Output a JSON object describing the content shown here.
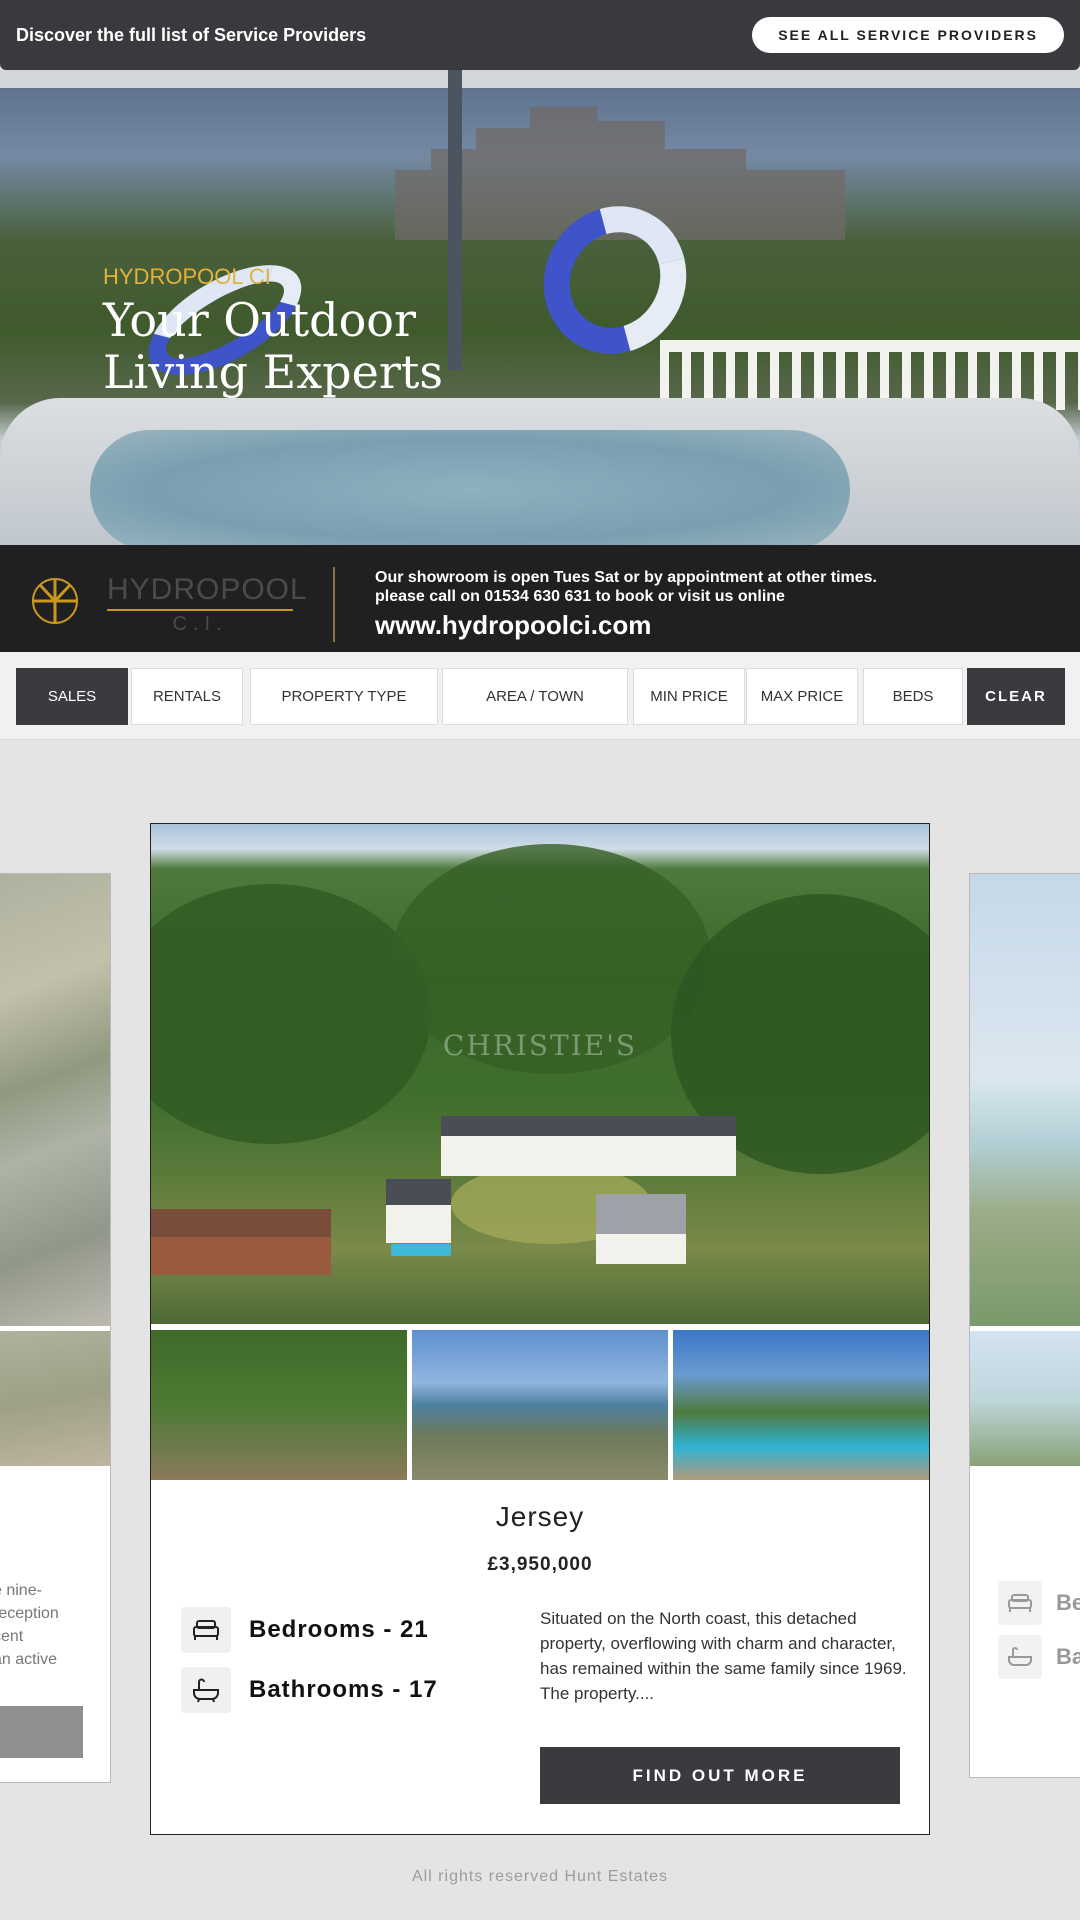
{
  "topbar": {
    "text": "Discover the full list of Service Providers",
    "button_label": "SEE ALL SERVICE PROVIDERS"
  },
  "advert": {
    "subtitle": "HYDROPOOL CI",
    "headline": "Your Outdoor Living Experts",
    "brand": "HYDROPOOL",
    "brand_sub": "C.I.",
    "info_line1": "Our showroom is open Tues Sat or by appointment at other times.",
    "info_line2": "please call on 01534 630 631 to book or visit us online",
    "url": "www.hydropoolci.com"
  },
  "filters": {
    "sales": "SALES",
    "rentals": "RENTALS",
    "property_type": "PROPERTY TYPE",
    "area_town": "AREA / TOWN",
    "min_price": "MIN PRICE",
    "max_price": "MAX PRICE",
    "beds": "BEDS",
    "clear": "CLEAR"
  },
  "left_card": {
    "desc_lines": [
      "e nine-",
      "reception",
      "cent",
      "an active"
    ]
  },
  "right_card": {
    "feature1": "Be",
    "feature2": "Ba"
  },
  "listing": {
    "watermark": "CHRISTIE'S",
    "location": "Jersey",
    "price": "£3,950,000",
    "bedrooms": "Bedrooms - 21",
    "bathrooms": "Bathrooms - 17",
    "description": "Situated on the North coast, this detached property, overflowing with charm and character, has remained within the same family since 1969. The property....",
    "button_label": "FIND OUT MORE"
  },
  "icons": [
    "bed-icon",
    "bath-icon"
  ],
  "colors": {
    "dark": "#3b3b3f",
    "accent_gold": "#e3b23c",
    "background": "#e4e4e4"
  },
  "footer": {
    "text": "All rights reserved Hunt Estates"
  }
}
